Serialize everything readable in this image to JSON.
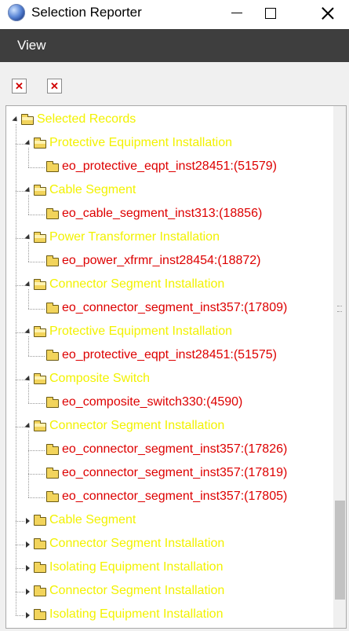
{
  "window": {
    "title": "Selection Reporter",
    "icon": "globe-icon"
  },
  "menu": {
    "items": [
      "View"
    ]
  },
  "toolbar": {
    "buttons": [
      {
        "icon": "red-x-icon",
        "glyph": "✕"
      },
      {
        "icon": "red-x-icon",
        "glyph": "✕"
      }
    ]
  },
  "tree": {
    "root": {
      "label": "Selected Records",
      "expanded": true
    },
    "groups": [
      {
        "label": "Protective Equipment Installation",
        "expanded": true,
        "children": [
          "eo_protective_eqpt_inst28451:(51579)"
        ]
      },
      {
        "label": "Cable Segment",
        "expanded": true,
        "children": [
          "eo_cable_segment_inst313:(18856)"
        ]
      },
      {
        "label": "Power Transformer Installation",
        "expanded": true,
        "children": [
          "eo_power_xfrmr_inst28454:(18872)"
        ]
      },
      {
        "label": "Connector Segment Installation",
        "expanded": true,
        "children": [
          "eo_connector_segment_inst357:(17809)"
        ]
      },
      {
        "label": "Protective Equipment Installation",
        "expanded": true,
        "children": [
          "eo_protective_eqpt_inst28451:(51575)"
        ]
      },
      {
        "label": "Composite Switch",
        "expanded": true,
        "children": [
          "eo_composite_switch330:(4590)"
        ]
      },
      {
        "label": "Connector Segment Installation",
        "expanded": true,
        "children": [
          "eo_connector_segment_inst357:(17826)",
          "eo_connector_segment_inst357:(17819)",
          "eo_connector_segment_inst357:(17805)"
        ]
      },
      {
        "label": "Cable Segment",
        "expanded": false,
        "children": []
      },
      {
        "label": "Connector Segment Installation",
        "expanded": false,
        "children": []
      },
      {
        "label": "Isolating Equipment Installation",
        "expanded": false,
        "children": []
      },
      {
        "label": "Connector Segment Installation",
        "expanded": false,
        "children": []
      },
      {
        "label": "Isolating Equipment Installation",
        "expanded": false,
        "children": []
      }
    ]
  },
  "colors": {
    "group_label": "#f2f200",
    "record_label": "#dd0000",
    "menubar_bg": "#3e3e3e"
  }
}
